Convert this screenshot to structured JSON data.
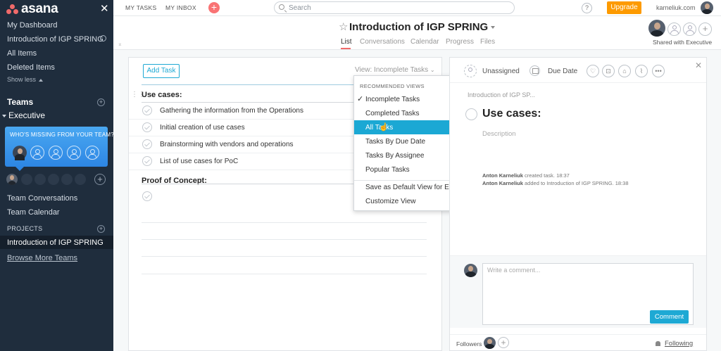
{
  "colors": {
    "sidebar_bg": "#1f2d3d",
    "accent_blue": "#1ea9d4",
    "upgrade_orange": "#fd9a00",
    "logo_coral": "#f06a6a",
    "quick_add": "#f97374",
    "menu_highlight": "#1ba8d4"
  },
  "sidebar": {
    "logo_text": "asana",
    "close_icon": "✕",
    "links": [
      "My Dashboard",
      "Introduction of IGP SPRING",
      "All Items",
      "Deleted Items"
    ],
    "show_less": "Show less",
    "teams_label": "Teams",
    "team_name": "Executive",
    "missing_prompt": "WHO'S MISSING FROM YOUR TEAM?",
    "team_links": [
      "Team Conversations",
      "Team Calendar"
    ],
    "projects_label": "PROJECTS",
    "active_project": "Introduction of IGP SPRING",
    "browse_more": "Browse More Teams"
  },
  "topbar": {
    "my_tasks": "MY TASKS",
    "my_inbox": "MY INBOX",
    "quick_add": "+",
    "search_placeholder": "Search",
    "help": "?",
    "upgrade": "Upgrade",
    "user": "karneliuk.com"
  },
  "project": {
    "title": "Introduction of IGP SPRING",
    "tabs": [
      "List",
      "Conversations",
      "Calendar",
      "Progress",
      "Files"
    ],
    "active_tab": "List",
    "shared_with": "Shared with Executive"
  },
  "task_list": {
    "add_task": "Add Task",
    "view_selector": "View: Incomplete Tasks",
    "sections": [
      {
        "name": "Use cases:",
        "tasks": [
          "Gathering the information from the Operations",
          "Initial creation of use cases",
          "Brainstorming with vendors and operations",
          "List of use cases for PoC"
        ]
      },
      {
        "name": "Proof of Concept:",
        "tasks": []
      }
    ]
  },
  "view_menu": {
    "header": "RECOMMENDED VIEWS",
    "items": [
      {
        "label": "Incomplete Tasks",
        "checked": true
      },
      {
        "label": "Completed Tasks",
        "submenu": true
      },
      {
        "label": "All Tasks",
        "highlighted": true
      },
      {
        "label": "Tasks By Due Date"
      },
      {
        "label": "Tasks By Assignee"
      },
      {
        "label": "Popular Tasks"
      }
    ],
    "actions": [
      "Save as Default View for Everyone",
      "Customize View"
    ]
  },
  "details": {
    "assignee": "Unassigned",
    "due_date": "Due Date",
    "breadcrumb": "Introduction of IGP SP...",
    "title": "Use cases:",
    "description_placeholder": "Description",
    "stories": [
      {
        "author": "Anton Karneliuk",
        "action": "created task.",
        "time": "18:37"
      },
      {
        "author": "Anton Karneliuk",
        "action": "added to Introduction of IGP SPRING.",
        "time": "18:38"
      }
    ],
    "comment_placeholder": "Write a comment...",
    "comment_button": "Comment",
    "followers_label": "Followers",
    "following": "Following"
  }
}
